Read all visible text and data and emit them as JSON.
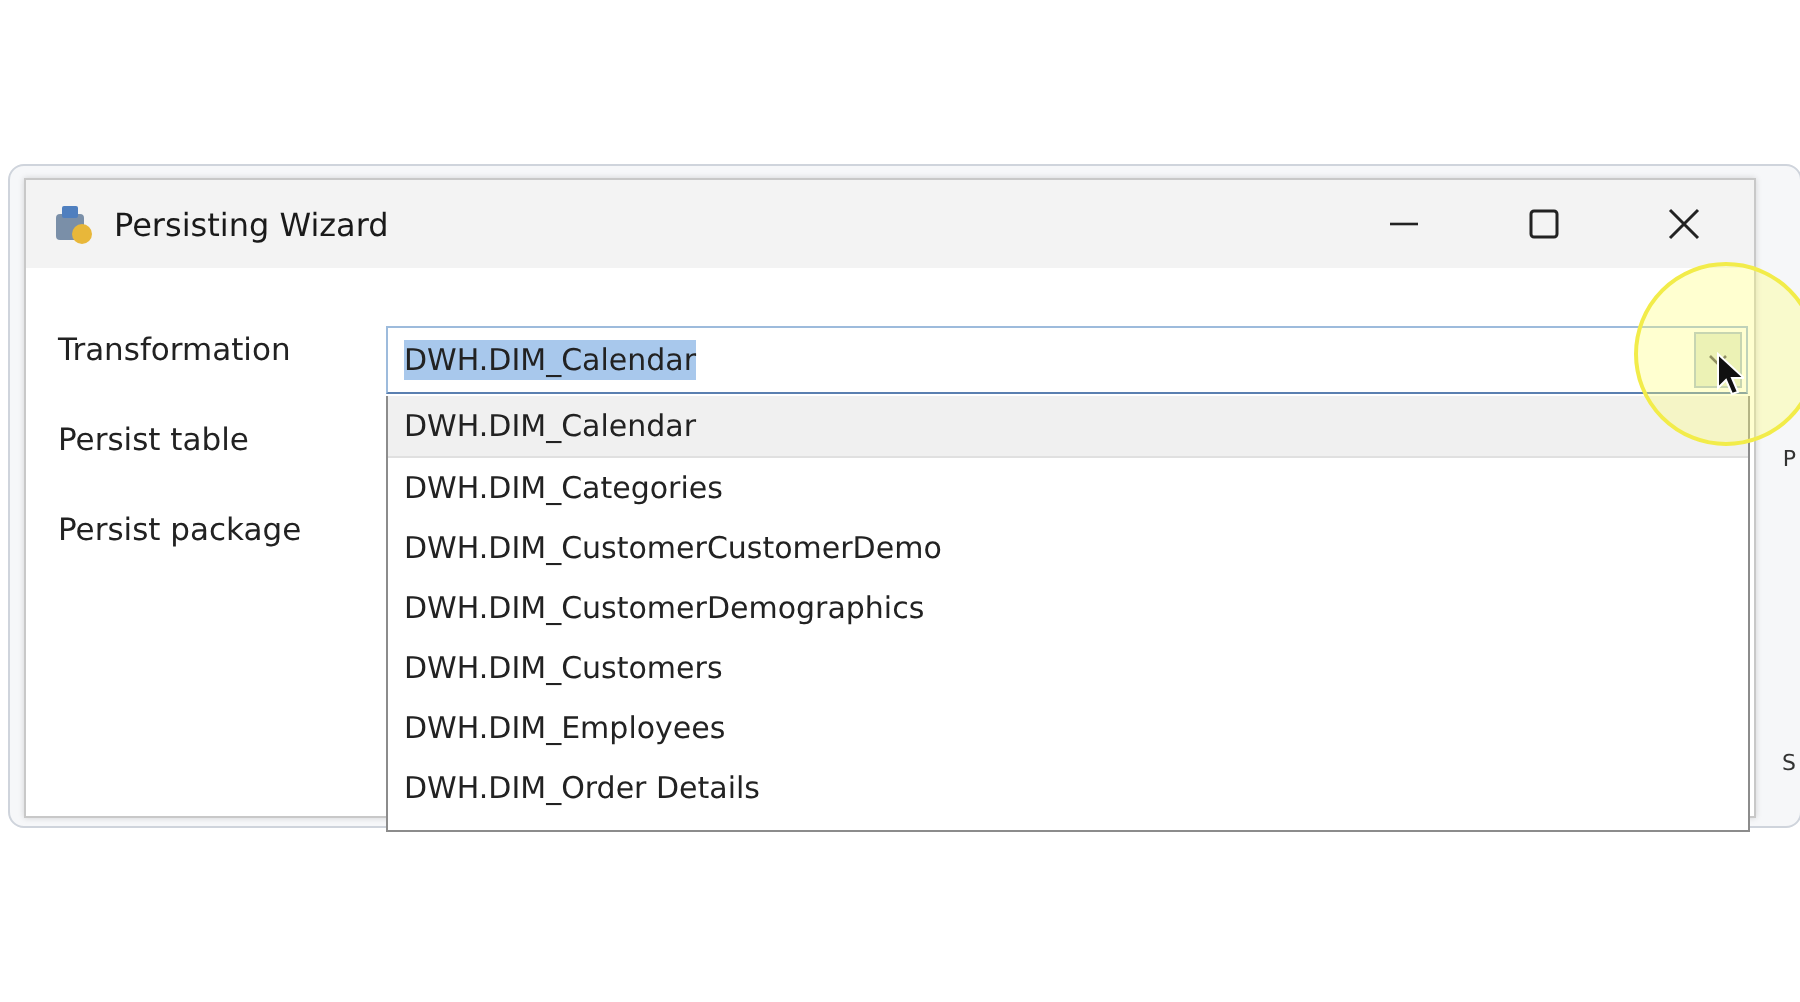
{
  "window": {
    "title": "Persisting Wizard"
  },
  "fields": [
    {
      "label": "Transformation"
    },
    {
      "label": "Persist table"
    },
    {
      "label": "Persist package"
    }
  ],
  "combo": {
    "value": "DWH.DIM_Calendar",
    "text_selected": true,
    "expanded": true
  },
  "options": [
    {
      "label": "DWH.DIM_Calendar",
      "selected": true
    },
    {
      "label": "DWH.DIM_Categories",
      "selected": false
    },
    {
      "label": "DWH.DIM_CustomerCustomerDemo",
      "selected": false
    },
    {
      "label": "DWH.DIM_CustomerDemographics",
      "selected": false
    },
    {
      "label": "DWH.DIM_Customers",
      "selected": false
    },
    {
      "label": "DWH.DIM_Employees",
      "selected": false
    },
    {
      "label": "DWH.DIM_Order Details",
      "selected": false
    }
  ],
  "background_fragments": [
    "P",
    "S"
  ]
}
